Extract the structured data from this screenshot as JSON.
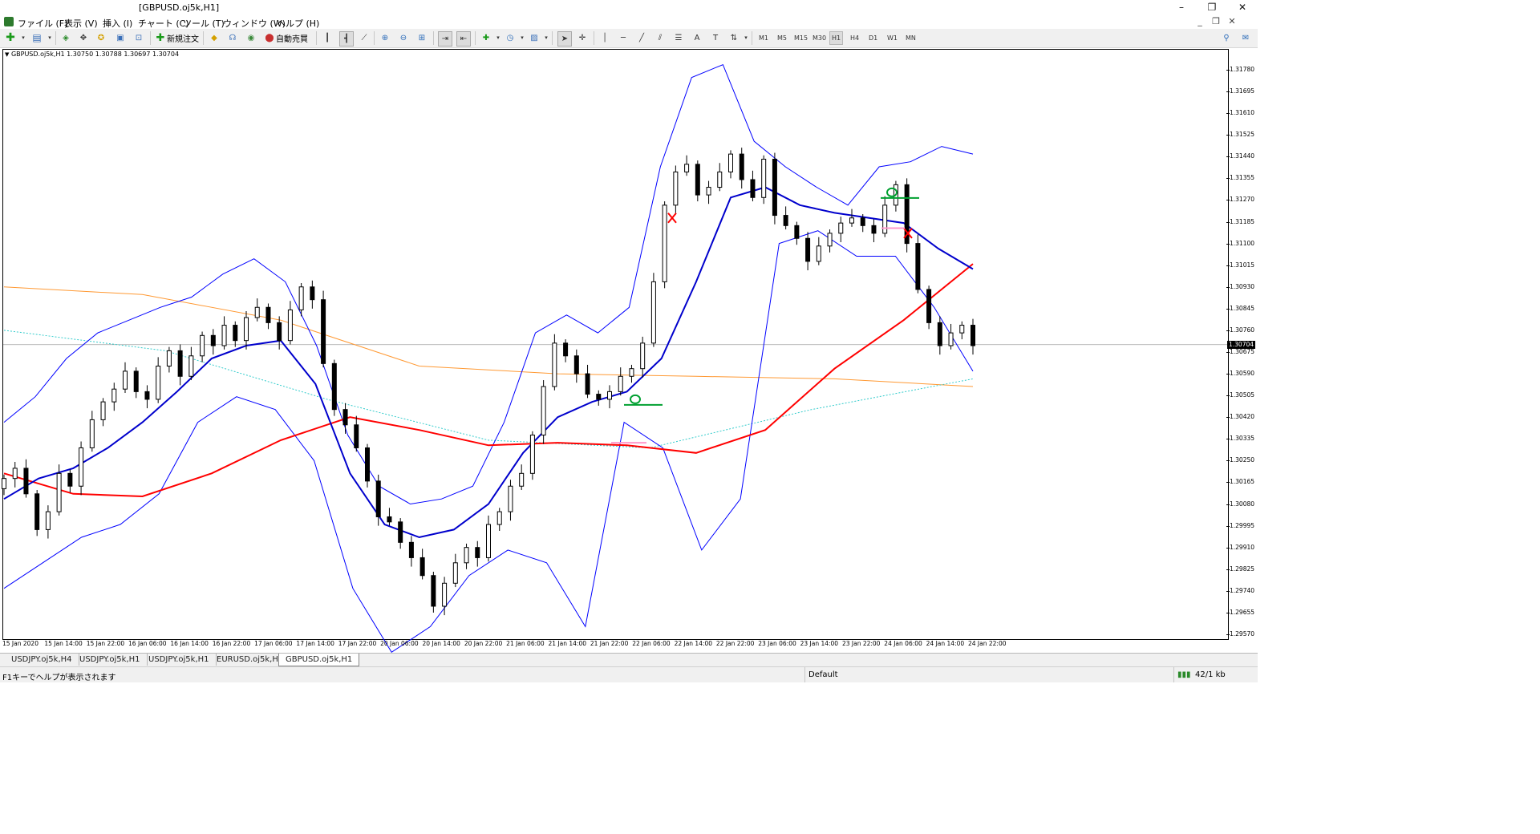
{
  "window": {
    "title": "[GBPUSD.oj5k,H1]",
    "controls": [
      "–",
      "❐",
      "✕"
    ]
  },
  "menu": [
    "ファイル (F)",
    "表示 (V)",
    "挿入 (I)",
    "チャート (C)",
    "ツール (T)",
    "ウィンドウ (W)",
    "ヘルプ (H)"
  ],
  "toolbar": {
    "new_order": "新規注文",
    "auto_trade": "自動売買",
    "timeframes": [
      "M1",
      "M5",
      "M15",
      "M30",
      "H1",
      "H4",
      "D1",
      "W1",
      "MN"
    ],
    "active_timeframe": "H1"
  },
  "chart": {
    "info": "GBPUSD.oj5k,H1  1.30750 1.30788 1.30697 1.30704",
    "current_price": "1.30704",
    "price_labels": [
      "1.31780",
      "1.31695",
      "1.31610",
      "1.31525",
      "1.31440",
      "1.31355",
      "1.31270",
      "1.31185",
      "1.31100",
      "1.31015",
      "1.30930",
      "1.30845",
      "1.30760",
      "1.30675",
      "1.30590",
      "1.30505",
      "1.30420",
      "1.30335",
      "1.30250",
      "1.30165",
      "1.30080",
      "1.29995",
      "1.29910",
      "1.29825",
      "1.29740",
      "1.29655",
      "1.29570"
    ],
    "time_labels": [
      "15 Jan 2020",
      "15 Jan 14:00",
      "15 Jan 22:00",
      "16 Jan 06:00",
      "16 Jan 14:00",
      "16 Jan 22:00",
      "17 Jan 06:00",
      "17 Jan 14:00",
      "17 Jan 22:00",
      "20 Jan 06:00",
      "20 Jan 14:00",
      "20 Jan 22:00",
      "21 Jan 06:00",
      "21 Jan 14:00",
      "21 Jan 22:00",
      "22 Jan 06:00",
      "22 Jan 14:00",
      "22 Jan 22:00",
      "23 Jan 06:00",
      "23 Jan 14:00",
      "23 Jan 22:00",
      "24 Jan 06:00",
      "24 Jan 14:00",
      "24 Jan 22:00"
    ],
    "colors": {
      "candle": "#000000",
      "bollinger": "#0000ff",
      "bollinger_mid": "#0000cc",
      "ma_red": "#ff0000",
      "ma_orange": "#ff9933",
      "ma_cyan": "#33cccc",
      "signal_green": "#00a030",
      "signal_red": "#ff0000",
      "signal_pink": "#ff99cc"
    }
  },
  "chart_data": {
    "type": "candlestick",
    "symbol": "GBPUSD.oj5k",
    "timeframe": "H1",
    "ohlc_last": {
      "open": 1.3075,
      "high": 1.30788,
      "low": 1.30697,
      "close": 1.30704
    },
    "ylim": [
      1.2957,
      1.3178
    ],
    "x_range": [
      "15 Jan 2020",
      "24 Jan 22:00"
    ],
    "series": [
      {
        "name": "candles",
        "values": [
          1.3018,
          1.3022,
          1.3012,
          1.2998,
          1.3005,
          1.302,
          1.3015,
          1.303,
          1.3041,
          1.3048,
          1.3053,
          1.306,
          1.3052,
          1.3049,
          1.3062,
          1.3068,
          1.3058,
          1.3066,
          1.3074,
          1.307,
          1.3078,
          1.3072,
          1.3081,
          1.3085,
          1.3079,
          1.3072,
          1.3084,
          1.3093,
          1.3088,
          1.3063,
          1.3045,
          1.3039,
          1.303,
          1.3017,
          1.3003,
          1.3001,
          1.2993,
          1.2987,
          1.298,
          1.2968,
          1.2977,
          1.2985,
          1.2991,
          1.2987,
          1.3,
          1.3005,
          1.3015,
          1.302,
          1.3035,
          1.3054,
          1.3071,
          1.3066,
          1.3059,
          1.3051,
          1.3049,
          1.3052,
          1.3058,
          1.3061,
          1.3071,
          1.3095,
          1.3125,
          1.3138,
          1.3141,
          1.3129,
          1.3132,
          1.3138,
          1.3145,
          1.3135,
          1.3128,
          1.3143,
          1.3121,
          1.3117,
          1.3112,
          1.3103,
          1.3109,
          1.3114,
          1.3118,
          1.312,
          1.3117,
          1.3114,
          1.3125,
          1.3133,
          1.311,
          1.3092,
          1.3079,
          1.307,
          1.3075,
          1.3078,
          1.307
        ]
      },
      {
        "name": "bollinger_upper",
        "values": [
          1.304,
          1.305,
          1.3065,
          1.3075,
          1.308,
          1.3085,
          1.3089,
          1.3098,
          1.3104,
          1.3095,
          1.307,
          1.3035,
          1.3015,
          1.3008,
          1.301,
          1.3015,
          1.304,
          1.3075,
          1.3082,
          1.3075,
          1.3085,
          1.314,
          1.3175,
          1.318,
          1.315,
          1.314,
          1.3132,
          1.3125,
          1.314,
          1.3142,
          1.3148,
          1.3145
        ]
      },
      {
        "name": "bollinger_mid",
        "values": [
          1.301,
          1.3018,
          1.3022,
          1.303,
          1.304,
          1.3052,
          1.3065,
          1.307,
          1.3072,
          1.3055,
          1.302,
          1.3,
          1.2995,
          1.2998,
          1.3008,
          1.3028,
          1.3042,
          1.3048,
          1.3052,
          1.3065,
          1.3095,
          1.3128,
          1.3132,
          1.3125,
          1.3122,
          1.312,
          1.3118,
          1.3108,
          1.31
        ]
      },
      {
        "name": "bollinger_lower",
        "values": [
          1.2975,
          1.2985,
          1.2995,
          1.3,
          1.3012,
          1.304,
          1.305,
          1.3045,
          1.3025,
          1.2975,
          1.295,
          1.296,
          1.298,
          1.299,
          1.2985,
          1.296,
          1.304,
          1.303,
          1.299,
          1.301,
          1.311,
          1.3115,
          1.3105,
          1.3105,
          1.3085,
          1.306
        ]
      },
      {
        "name": "ma_red",
        "values": [
          1.302,
          1.3012,
          1.3011,
          1.302,
          1.3033,
          1.3042,
          1.3037,
          1.3031,
          1.3032,
          1.3031,
          1.3028,
          1.3037,
          1.3061,
          1.308,
          1.3102
        ]
      },
      {
        "name": "ma_orange",
        "values": [
          1.3093,
          1.309,
          1.308,
          1.3062,
          1.3059,
          1.3058,
          1.3057,
          1.3054
        ]
      },
      {
        "name": "ma_cyan",
        "values": [
          1.3076,
          1.3068,
          1.3049,
          1.3033,
          1.303,
          1.3045,
          1.3057
        ]
      }
    ]
  },
  "tabs": [
    "USDJPY.oj5k,H4",
    "USDJPY.oj5k,H1",
    "USDJPY.oj5k,H1",
    "EURUSD.oj5k,H1",
    "GBPUSD.oj5k,H1"
  ],
  "active_tab": "GBPUSD.oj5k,H1",
  "status": {
    "help": "F1キーでヘルプが表示されます",
    "profile": "Default",
    "traffic": "42/1 kb"
  }
}
